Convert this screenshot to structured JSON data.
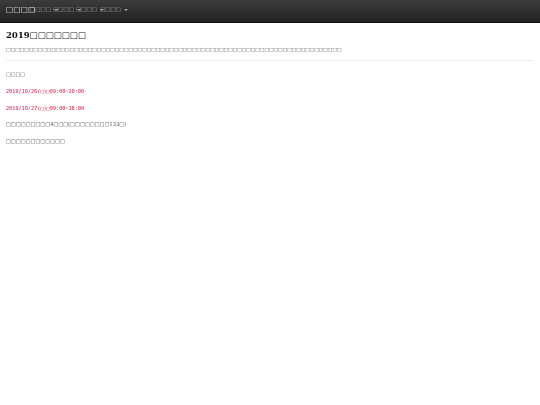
{
  "navbar": {
    "brand": "□□□□",
    "menus": [
      {
        "label": "□□□□"
      },
      {
        "label": "□□□□"
      },
      {
        "label": "□□□□"
      },
      {
        "label": "□□□□"
      }
    ]
  },
  "main": {
    "title": "2019□□□□□□□",
    "description": "□□□□□□□□□□□□□□□□□□□□□□□□□□□□□□□□□□□□□□□□□□□□□□□□□□□□□□□□□□□□□□□□□□□□□□□□□□",
    "section_label": "□□□□",
    "schedule": [
      "2019/10/26(□)□09:00~20:00",
      "2019/10/27(□)□09:00~18:00"
    ],
    "notes": [
      "□□□□□□□□□4□□□(□□□□□□□□133□)",
      "□□□□□□□□□□□□"
    ]
  },
  "colors": {
    "navbar_bg": "#2b2b2b",
    "schedule_text": "#dd1144"
  }
}
